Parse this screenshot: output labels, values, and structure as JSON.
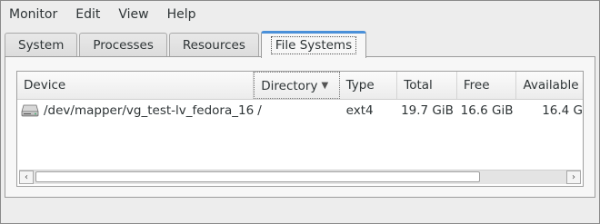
{
  "menubar": {
    "items": [
      "Monitor",
      "Edit",
      "View",
      "Help"
    ]
  },
  "tabs": [
    {
      "label": "System",
      "active": false
    },
    {
      "label": "Processes",
      "active": false
    },
    {
      "label": "Resources",
      "active": false
    },
    {
      "label": "File Systems",
      "active": true
    }
  ],
  "table": {
    "columns": [
      "Device",
      "Directory",
      "Type",
      "Total",
      "Free",
      "Available"
    ],
    "sorted_column": "Directory",
    "sort_direction": "descending",
    "rows": [
      {
        "icon": "harddisk-icon",
        "device": "/dev/mapper/vg_test-lv_fedora_16",
        "directory": "/",
        "type": "ext4",
        "total": "19.7 GiB",
        "free": "16.6 GiB",
        "available": "16.4 G"
      }
    ]
  },
  "scrollbar": {
    "left_arrow": "‹",
    "right_arrow": "›",
    "position_fraction": 0.0,
    "visible_fraction": 0.84
  },
  "colors": {
    "accent": "#4a90d9",
    "window_bg": "#ededed"
  }
}
